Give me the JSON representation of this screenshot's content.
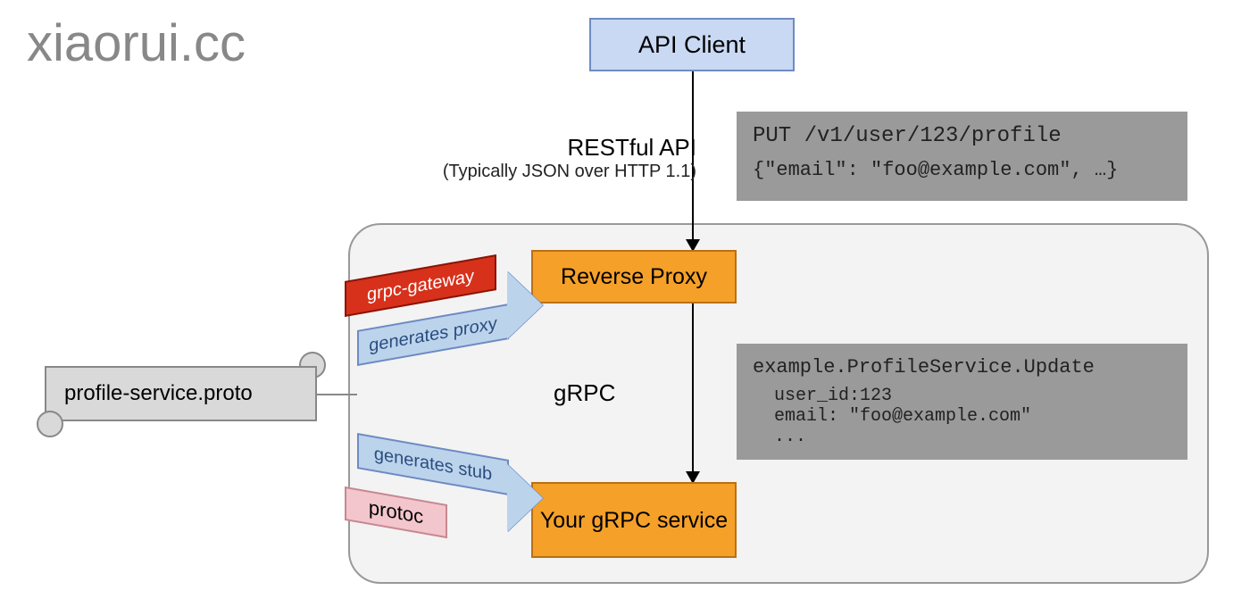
{
  "watermark": "xiaorui.cc",
  "nodes": {
    "api_client": "API Client",
    "reverse_proxy": "Reverse Proxy",
    "grpc_service": "Your gRPC service",
    "proto_file": "profile-service.proto"
  },
  "arrows": {
    "grpc_gateway": "grpc-gateway",
    "generates_proxy": "generates proxy",
    "generates_stub": "generates stub",
    "protoc": "protoc"
  },
  "labels": {
    "restful_title": "RESTful API",
    "restful_sub": "(Typically JSON over HTTP 1.1)",
    "grpc": "gRPC"
  },
  "code": {
    "rest_request_line": "PUT /v1/user/123/profile",
    "rest_body": "{\"email\": \"foo@example.com\", …}",
    "grpc_method": "example.ProfileService.Update",
    "grpc_field1": "user_id:123",
    "grpc_field2": "email: \"foo@example.com\"",
    "grpc_field3": "..."
  }
}
